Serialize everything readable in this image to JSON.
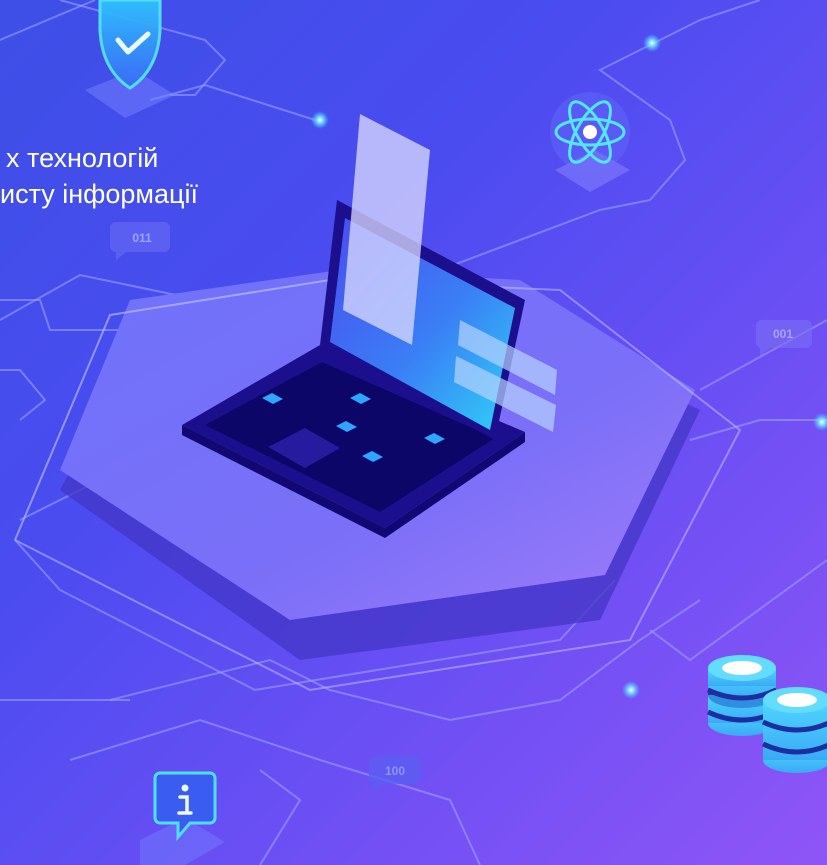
{
  "headline": {
    "line1": "х технологій",
    "line2": "исту інформації"
  },
  "badges": {
    "top_left": "011",
    "right": "001",
    "bottom": "100"
  },
  "icons": [
    "shield-check-icon",
    "atom-icon",
    "info-icon",
    "database-icon",
    "laptop-icon"
  ],
  "colors": {
    "background_start": "#3d4fe6",
    "background_end": "#8f55f6",
    "accent_glow": "#3ad6ff",
    "laptop_body": "#1a0f8c",
    "platform": "#6a6cf7"
  }
}
